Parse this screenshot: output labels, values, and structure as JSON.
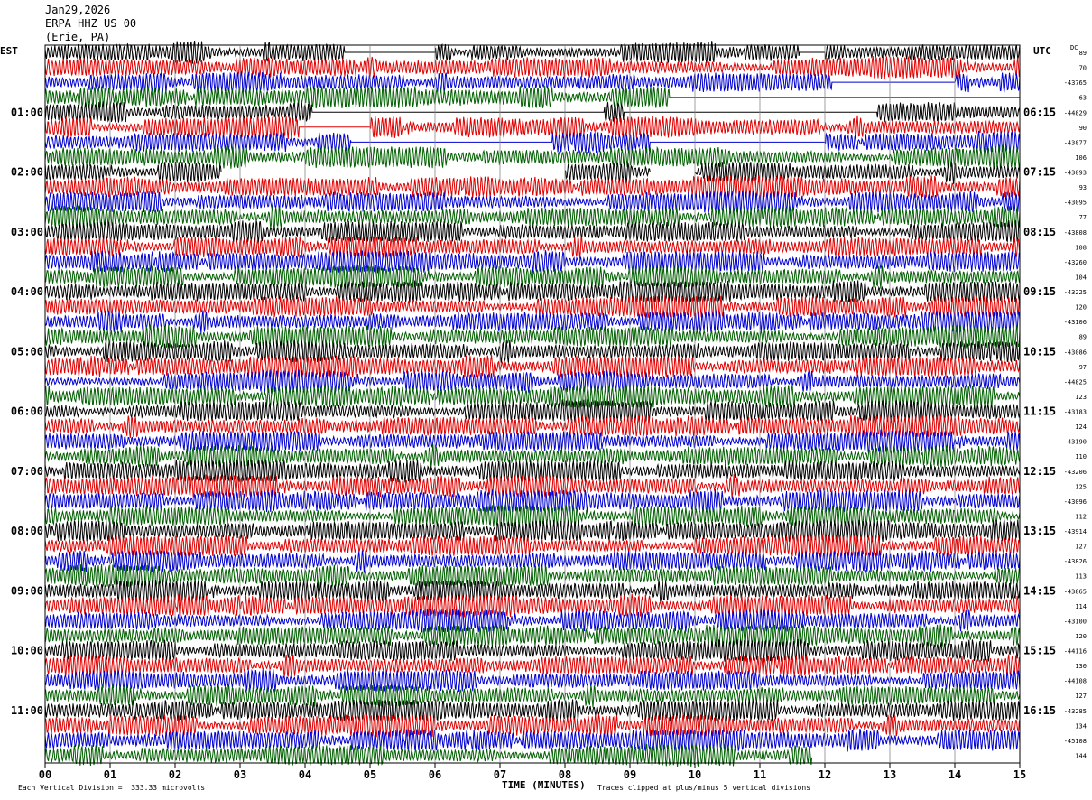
{
  "header": {
    "date": "Jan29,2026",
    "station": "ERPA HHZ US 00",
    "location": "(Erie, PA)"
  },
  "left_tz": "EST",
  "right_tz": "UTC",
  "dc_label": "DC",
  "footer": {
    "scale": "Each Vertical Division =  333.33 microvolts",
    "xlabel": "TIME (MINUTES)",
    "clip_note": "Traces clipped at plus/minus 5 vertical divisions"
  },
  "colors": [
    "#000000",
    "#e00000",
    "#0000d0",
    "#006000"
  ],
  "chart_data": {
    "type": "line",
    "title": "",
    "xlabel": "TIME (MINUTES)",
    "ylabel": "",
    "xlim": [
      0,
      15
    ],
    "x_ticks": [
      "00",
      "01",
      "02",
      "03",
      "04",
      "05",
      "06",
      "07",
      "08",
      "09",
      "10",
      "11",
      "12",
      "13",
      "14",
      "15"
    ],
    "rows_per_hour": 4,
    "minutes_per_row": 15,
    "left_hour_labels": [
      "01:00",
      "02:00",
      "03:00",
      "04:00",
      "05:00",
      "06:00",
      "07:00",
      "08:00",
      "09:00",
      "10:00",
      "11:00"
    ],
    "right_hour_labels": [
      "06:15",
      "07:15",
      "08:15",
      "09:15",
      "10:15",
      "11:15",
      "12:15",
      "13:15",
      "14:15",
      "15:15",
      "16:15"
    ],
    "dc_offsets": [
      "89",
      "70",
      "-43765",
      "63",
      "-44829",
      "90",
      "-43877",
      "106",
      "-43093",
      "93",
      "-43095",
      "77",
      "-43808",
      "108",
      "-43260",
      "104",
      "-43225",
      "120",
      "-43106",
      "89",
      "-43086",
      "97",
      "-44825",
      "123",
      "-43183",
      "124",
      "-43190",
      "110",
      "-43206",
      "125",
      "-43096",
      "112",
      "-43914",
      "127",
      "-43826",
      "113",
      "-43865",
      "114",
      "-43100",
      "120",
      "-44116",
      "130",
      "-44108",
      "127",
      "-43285",
      "134",
      "-45108",
      "144"
    ],
    "series": [
      {
        "values": [
          0,
          0,
          0,
          0,
          0
        ]
      }
    ],
    "grid": true,
    "clip_divisions": 5,
    "last_row_end_minute": 11.8,
    "gaps": [
      {
        "row": 0,
        "start": 4.6,
        "end": 6.0
      },
      {
        "row": 0,
        "start": 11.6,
        "end": 12.0
      },
      {
        "row": 2,
        "start": 12.1,
        "end": 14.0
      },
      {
        "row": 3,
        "start": 9.6,
        "end": 15.0
      },
      {
        "row": 4,
        "start": 4.1,
        "end": 8.6
      },
      {
        "row": 4,
        "start": 8.9,
        "end": 12.8
      },
      {
        "row": 5,
        "start": 3.9,
        "end": 5.0
      },
      {
        "row": 6,
        "start": 4.7,
        "end": 7.8
      },
      {
        "row": 6,
        "start": 9.3,
        "end": 12.0
      },
      {
        "row": 8,
        "start": 2.7,
        "end": 8.0
      },
      {
        "row": 8,
        "start": 9.3,
        "end": 10.0
      }
    ]
  }
}
